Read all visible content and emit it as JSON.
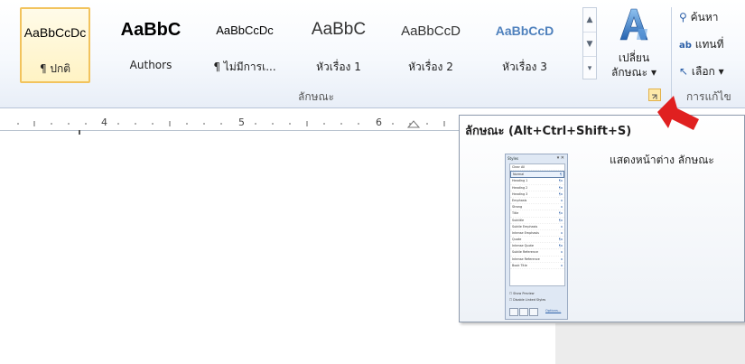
{
  "ribbon": {
    "styles_group_label": "ลักษณะ",
    "editing_group_label": "การแก้ไข",
    "style_tiles": [
      {
        "preview": "AaBbCcDc",
        "name": "¶ ปกติ",
        "selected": true
      },
      {
        "preview": "AaBbC",
        "name": "Authors",
        "selected": false
      },
      {
        "preview": "AaBbCcDc",
        "name": "¶ ไม่มีการเ...",
        "selected": false
      },
      {
        "preview": "AaBbC",
        "name": "หัวเรื่อง 1",
        "selected": false
      },
      {
        "preview": "AaBbCcD",
        "name": "หัวเรื่อง 2",
        "selected": false
      },
      {
        "preview": "AaBbCcD",
        "name": "หัวเรื่อง 3",
        "selected": false
      }
    ],
    "change_styles": {
      "line1": "เปลี่ยน",
      "line2": "ลักษณะ ▾"
    },
    "editing": {
      "find": "ค้นหา",
      "replace": "แทนที่",
      "select": "เลือก ▾"
    }
  },
  "ruler": {
    "ticks": [
      "4",
      "5",
      "6"
    ]
  },
  "tooltip": {
    "title": "ลักษณะ (Alt+Ctrl+Shift+S)",
    "description": "แสดงหน้าต่าง ลักษณะ",
    "pane": {
      "header": "Styles",
      "clear": "Clear All",
      "rows": [
        "Normal",
        "Heading 1",
        "Heading 2",
        "Heading 3",
        "Emphasis",
        "Strong",
        "Title",
        "Subtitle",
        "Subtle Emphasis",
        "Intense Emphasis",
        "Quote",
        "Intense Quote",
        "Subtle Reference",
        "Intense Reference",
        "Book Title"
      ],
      "show_preview": "Show Preview",
      "disable_linked": "Disable Linked Styles",
      "options": "Options..."
    }
  },
  "colors": {
    "accent_blue": "#2b5fa8",
    "selection_gold": "#f2c35d",
    "arrow_red": "#e02020"
  }
}
